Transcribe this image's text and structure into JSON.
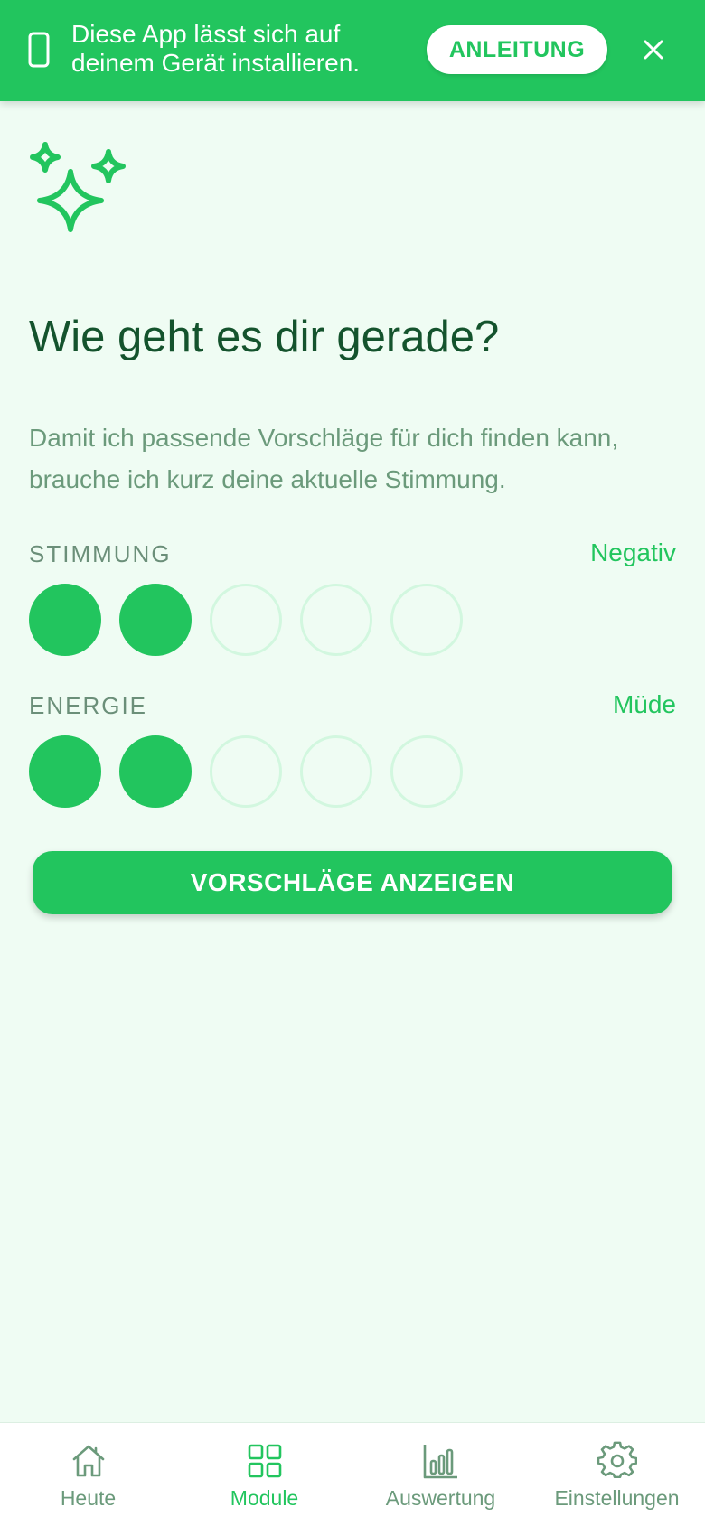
{
  "banner": {
    "message": "Diese App lässt sich auf deinem Gerät installieren.",
    "guide_label": "ANLEITUNG",
    "icon": "phone-icon",
    "close_icon": "close-icon"
  },
  "header": {
    "icon": "sparkles-icon",
    "title": "Wie geht es dir gerade?",
    "description": "Damit ich passende Vorschläge für dich finden kann, brauche ich kurz deine aktuelle Stimmung."
  },
  "mood": {
    "label": "STIMMUNG",
    "value": "Negativ",
    "level": 2,
    "max": 5
  },
  "energy": {
    "label": "ENERGIE",
    "value": "Müde",
    "level": 2,
    "max": 5
  },
  "cta_label": "VORSCHLÄGE ANZEIGEN",
  "nav": [
    {
      "label": "Heute",
      "icon": "home-icon",
      "active": false
    },
    {
      "label": "Module",
      "icon": "grid-icon",
      "active": true
    },
    {
      "label": "Auswertung",
      "icon": "bar-chart-icon",
      "active": false
    },
    {
      "label": "Einstellungen",
      "icon": "gear-icon",
      "active": false
    }
  ],
  "colors": {
    "accent": "#22c55e",
    "background": "#effcf3",
    "title": "#14532d",
    "muted": "#6b9a7b"
  }
}
